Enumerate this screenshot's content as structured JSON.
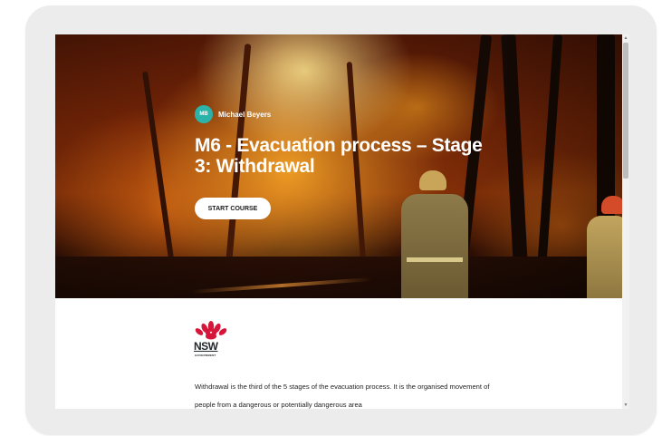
{
  "course": {
    "author_initials": "MB",
    "author_name": "Michael Beyers",
    "title": "M6 - Evacuation process – Stage 3: Withdrawal",
    "start_button_label": "START COURSE"
  },
  "logo": {
    "wordmark": "NSW",
    "subtitle": "GOVERNMENT"
  },
  "content": {
    "intro_paragraph": "Withdrawal is the third of the 5 stages of the evacuation process. It is the organised movement of people from a dangerous or potentially dangerous area"
  },
  "scrollbar": {
    "up_arrow": "▲",
    "down_arrow": "▼"
  },
  "colors": {
    "avatar": "#2bb3a9",
    "waratah_red": "#d7153a",
    "nsw_navy": "#22272b",
    "device_frame": "#ececec"
  }
}
